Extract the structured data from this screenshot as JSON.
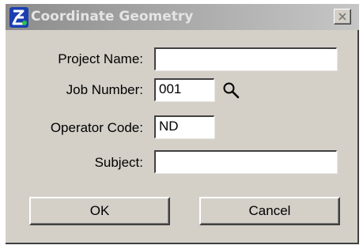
{
  "window": {
    "title": "Coordinate Geometry",
    "title_icon": "bentley-b-icon",
    "close_icon": "close-icon"
  },
  "form": {
    "project_name": {
      "label": "Project Name:",
      "value": ""
    },
    "job_number": {
      "label": "Job Number:",
      "value": "001",
      "lookup_icon": "search-icon"
    },
    "operator_code": {
      "label": "Operator Code:",
      "value": "ND"
    },
    "subject": {
      "label": "Subject:",
      "value": ""
    }
  },
  "buttons": {
    "ok_label": "OK",
    "cancel_label": "Cancel"
  },
  "colors": {
    "dialog_face": "#d4d0c8",
    "titlebar_inactive": "#a7a7a7",
    "title_text": "#e4e4e4",
    "field_background": "#ffffff"
  }
}
